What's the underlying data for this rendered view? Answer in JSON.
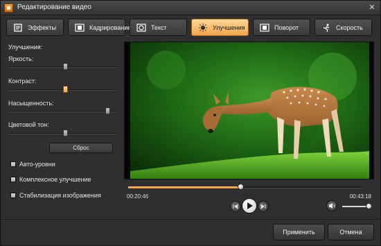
{
  "window": {
    "title": "Редактирование видео"
  },
  "tabs": [
    {
      "label": "Эффекты",
      "icon": "effects-icon"
    },
    {
      "label": "Кадрирование",
      "icon": "crop-icon"
    },
    {
      "label": "Текст",
      "icon": "text-icon"
    },
    {
      "label": "Улучшения",
      "icon": "enhance-icon",
      "active": true
    },
    {
      "label": "Поворот",
      "icon": "rotate-icon"
    },
    {
      "label": "Скорость",
      "icon": "speed-icon"
    }
  ],
  "enhancements": {
    "heading": "Улучшения:",
    "sliders": [
      {
        "label": "Яркость:",
        "value": 0.55
      },
      {
        "label": "Контраст:",
        "value": 0.55
      },
      {
        "label": "Насыщенность:",
        "value": 0.95
      },
      {
        "label": "Цветовой тон:",
        "value": 0.55
      }
    ],
    "reset_label": "Сброс",
    "checkboxes": [
      {
        "label": "Авто-уровни",
        "checked": false
      },
      {
        "label": "Комплексное улучшение",
        "checked": false
      },
      {
        "label": "Стабилизация изображения",
        "checked": false
      }
    ]
  },
  "player": {
    "current_time": "00:20:46",
    "total_time": "00:43:18",
    "progress": 0.48,
    "volume": 0.95
  },
  "footer": {
    "apply_label": "Применить",
    "cancel_label": "Отмена"
  },
  "colors": {
    "accent": "#f3a74a",
    "background": "#2f2f2f"
  }
}
